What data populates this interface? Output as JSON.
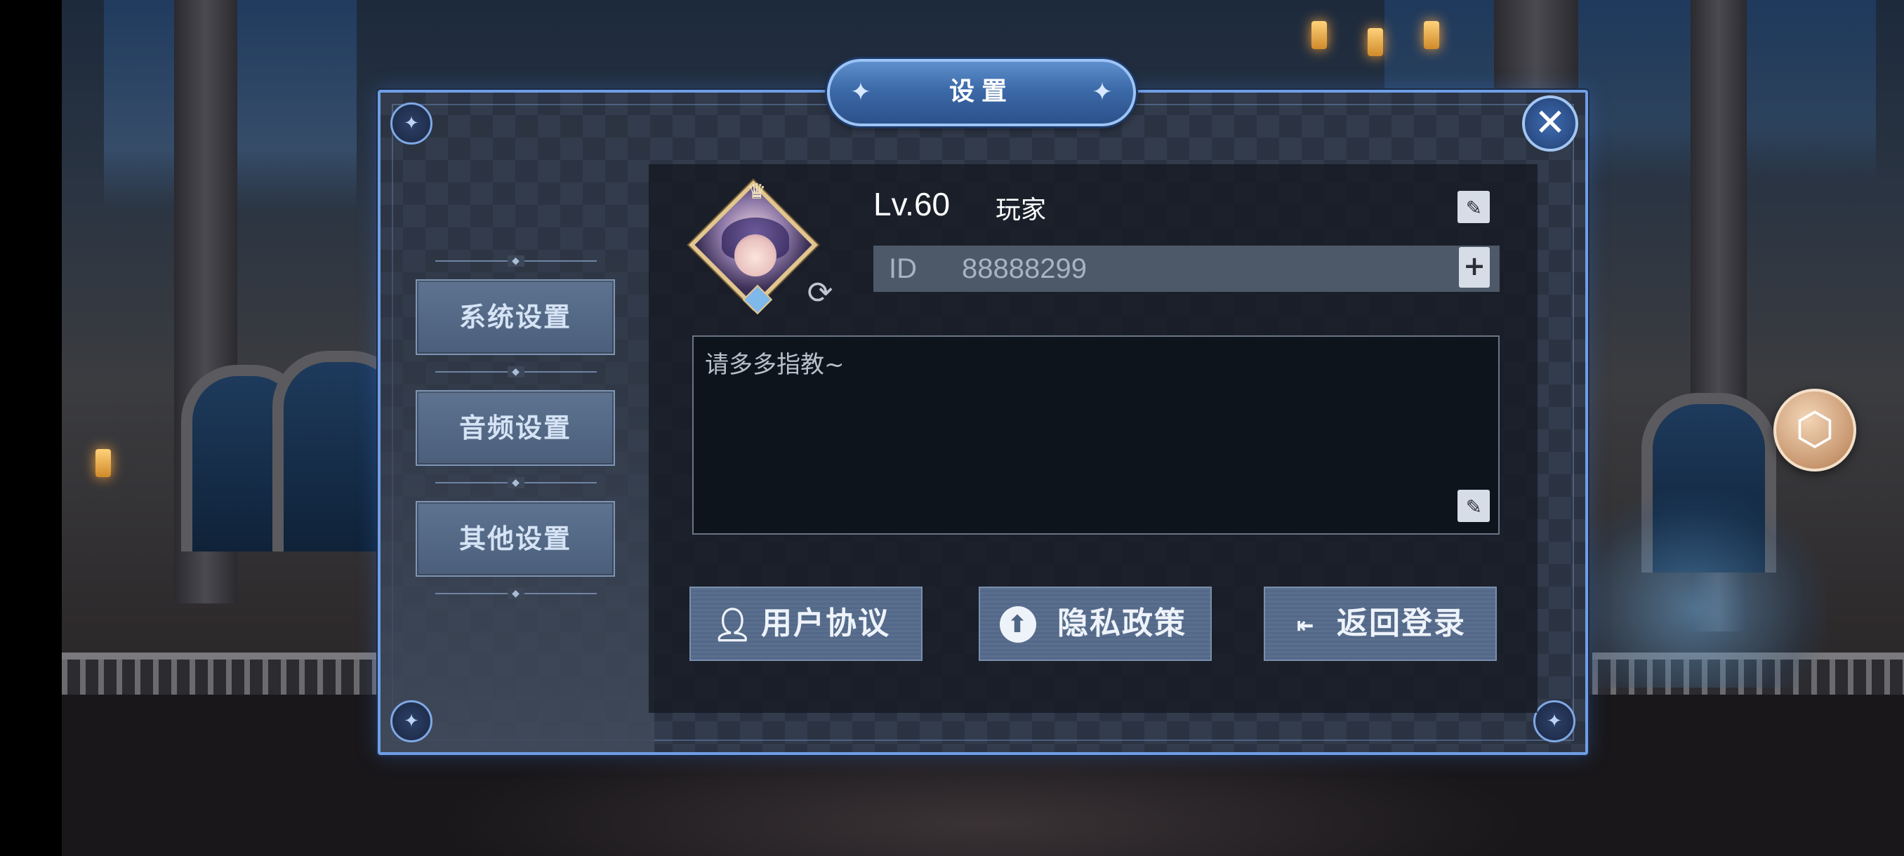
{
  "dialog": {
    "title": "设置",
    "close_glyph": "✕"
  },
  "sidebar": {
    "items": [
      {
        "label": "系统设置"
      },
      {
        "label": "音频设置"
      },
      {
        "label": "其他设置"
      }
    ]
  },
  "profile": {
    "level": "Lv.60",
    "name": "玩家",
    "id_label": "ID",
    "id_value": "88888299",
    "bio": "请多多指教~"
  },
  "actions": {
    "user_agreement": "用户协议",
    "privacy_policy": "隐私政策",
    "back_to_login": "返回登录"
  },
  "icons": {
    "close": "close-icon",
    "edit": "edit-icon",
    "copy": "copy-icon",
    "refresh": "refresh-icon",
    "user": "user-icon",
    "privacy": "upload-circle-icon",
    "logout": "logout-icon",
    "cube": "cube-icon"
  },
  "colors": {
    "frame": "#6f9ee6",
    "title_plate": "#3c6aa8",
    "nav_button": "#4b5f7b",
    "action_button": "#53688a"
  }
}
